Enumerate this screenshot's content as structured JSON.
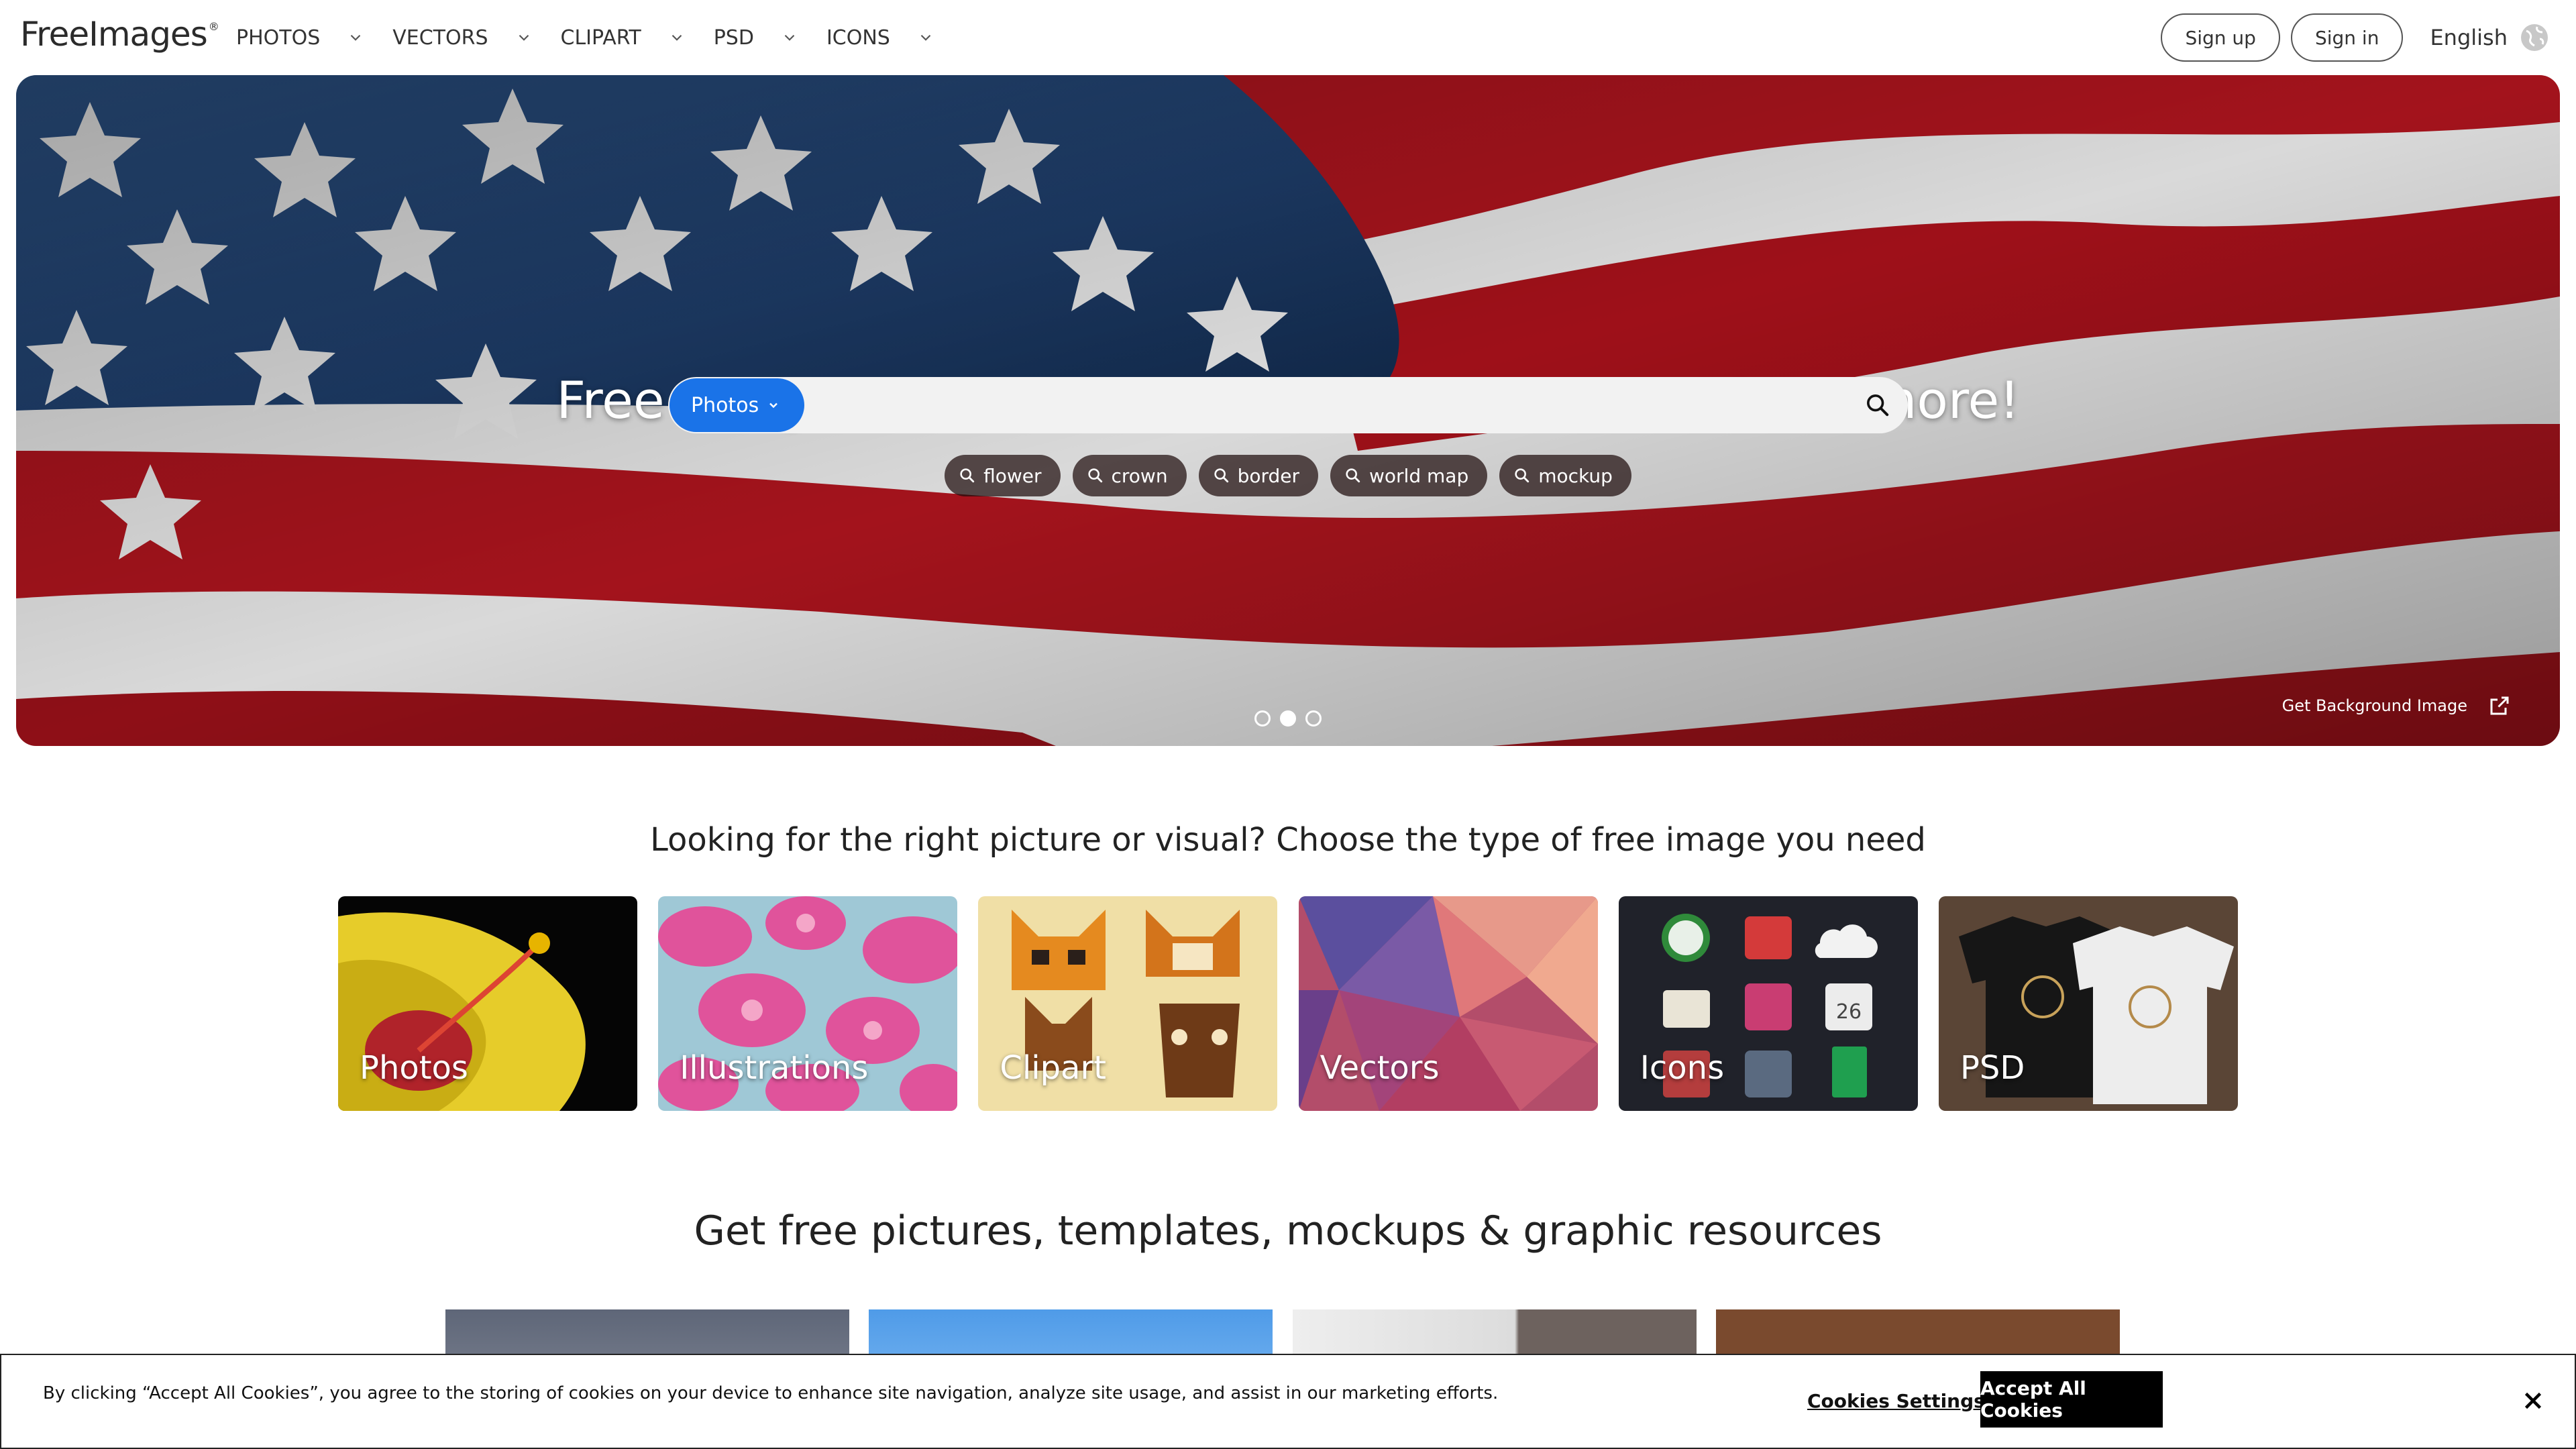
{
  "header": {
    "logo_text": "FreeImages",
    "logo_mark": "®",
    "nav": [
      {
        "label": "PHOTOS"
      },
      {
        "label": "VECTORS"
      },
      {
        "label": "CLIPART"
      },
      {
        "label": "PSD"
      },
      {
        "label": "ICONS"
      }
    ],
    "sign_up": "Sign up",
    "sign_in": "Sign in",
    "language": "English"
  },
  "hero": {
    "title": "Free Images: Photos, Vectors, Clipart, Icons, PSD & more!",
    "search_type": "Photos",
    "search_placeholder": "",
    "tags": [
      "flower",
      "crown",
      "border",
      "world map",
      "mockup"
    ],
    "slides": 3,
    "active_slide": 2,
    "bg_link": "Get Background Image"
  },
  "categories": {
    "title": "Looking for the right picture or visual? Choose the type of free image you need",
    "items": [
      {
        "label": "Photos"
      },
      {
        "label": "Illustrations"
      },
      {
        "label": "Clipart"
      },
      {
        "label": "Vectors"
      },
      {
        "label": "Icons"
      },
      {
        "label": "PSD"
      }
    ]
  },
  "resources": {
    "title": "Get free pictures, templates, mockups & graphic resources"
  },
  "cookie": {
    "text": "By clicking “Accept All Cookies”, you agree to the storing of cookies on your device to enhance site navigation, analyze site usage, and assist in our marketing efforts.",
    "settings": "Cookies Settings",
    "accept": "Accept All Cookies"
  },
  "colors": {
    "accent": "#1a73e8",
    "flag_blue": "#1d3b66",
    "flag_red": "#a3131c"
  }
}
